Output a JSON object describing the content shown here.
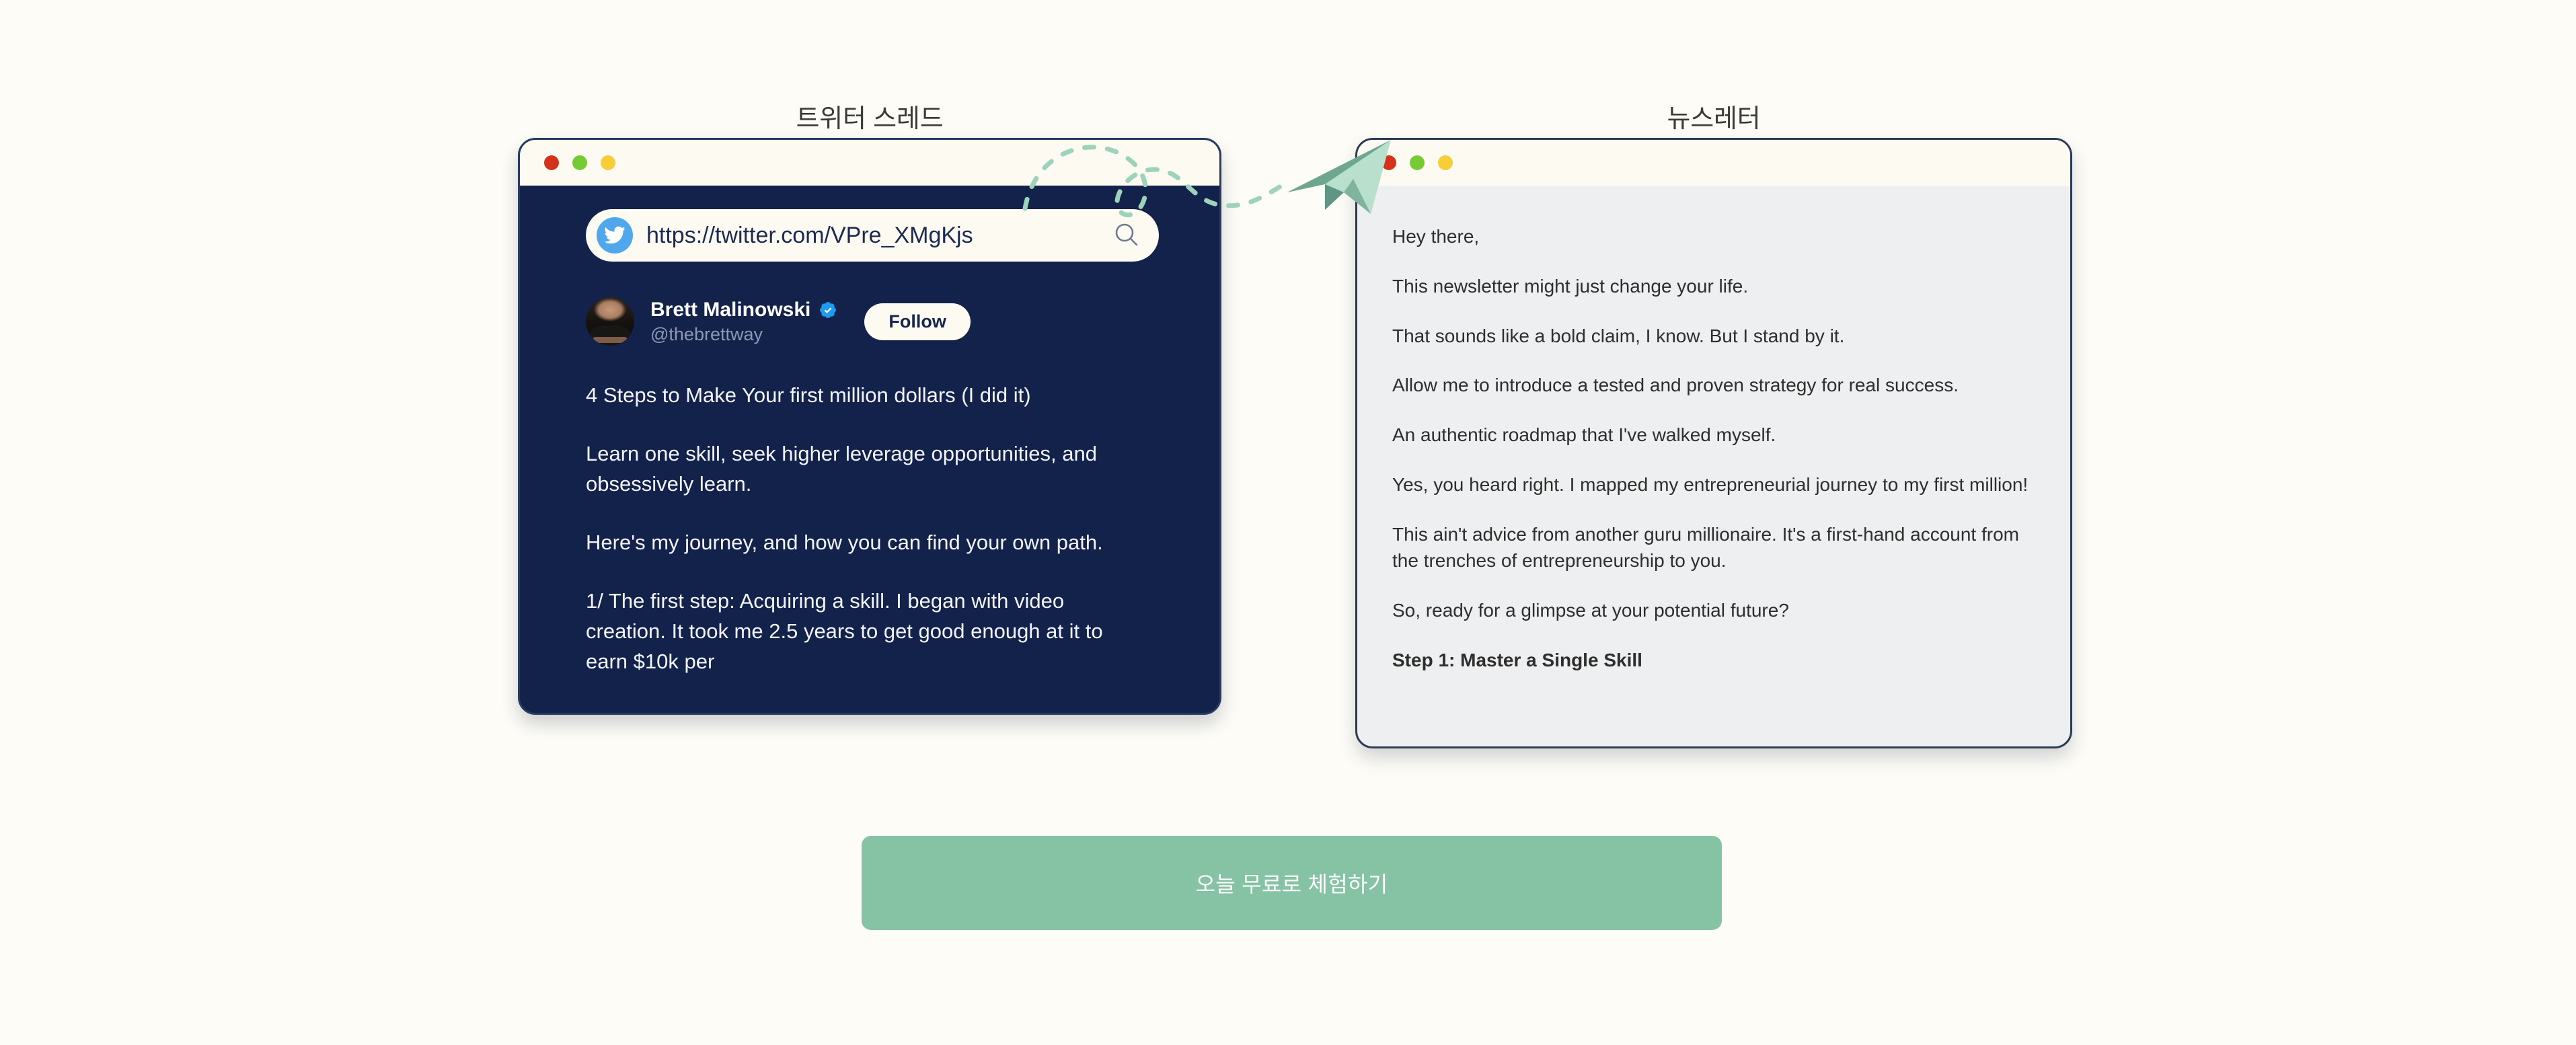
{
  "page": {
    "background_color": "#fdfcf7"
  },
  "panels": {
    "left_caption": "트위터 스레드",
    "right_caption": "뉴스레터"
  },
  "twitter_window": {
    "traffic_lights": [
      "red",
      "green",
      "yellow"
    ],
    "colors": {
      "body": "#13224a",
      "titlebar": "#fdfaf2",
      "red": "#d5321c",
      "green": "#76cb34",
      "yellow": "#f7cd38",
      "twitter_blue": "#51a7ec"
    },
    "urlbar": {
      "icon": "twitter-bird-icon",
      "url": "https://twitter.com/VPre_XMgKjs",
      "placeholder": "https://twitter.com/...",
      "search_icon": "search-icon"
    },
    "profile": {
      "avatar": "brett-malinowski-avatar",
      "display_name": "Brett Malinowski",
      "verified": true,
      "verified_icon": "verified-badge-icon",
      "handle": "@thebrettway",
      "follow_label": "Follow"
    },
    "tweet_paragraphs": [
      "4 Steps to Make Your first million dollars (I did it)",
      "Learn one skill, seek higher leverage opportunities, and obsessively learn.",
      "Here's my journey, and how you can find your own path.",
      "1/ The first step: Acquiring a skill. I began with video creation. It took me 2.5 years to get good enough at it to earn $10k per"
    ]
  },
  "newsletter_window": {
    "traffic_lights": [
      "red",
      "green",
      "yellow"
    ],
    "colors": {
      "body": "#eeeff0",
      "titlebar": "#fdfaf2",
      "border": "#2b3b56"
    },
    "paragraphs": [
      "Hey there,",
      "This newsletter might just change your life.",
      "That sounds like a bold claim, I know. But I stand by it.",
      "Allow me to introduce a tested and proven strategy for real success.",
      "An authentic roadmap that I've walked myself.",
      "Yes, you heard right. I mapped my entrepreneurial journey to my first million!",
      "This ain't advice from another guru millionaire. It's a first-hand account from the trenches of entrepreneurship to you.",
      "So, ready for a glimpse at your potential future?"
    ],
    "closing_heading": "Step 1: Master a Single Skill"
  },
  "connector": {
    "icon": "paper-plane-icon",
    "trail": "dashed-curve",
    "plane_color": "#a9d8c2",
    "plane_shade": "#6fa68f",
    "trail_color": "#9ed3bb"
  },
  "cta": {
    "label": "오늘 무료로 체험하기",
    "color": "#85c3a4",
    "text_color": "#ffffff"
  }
}
